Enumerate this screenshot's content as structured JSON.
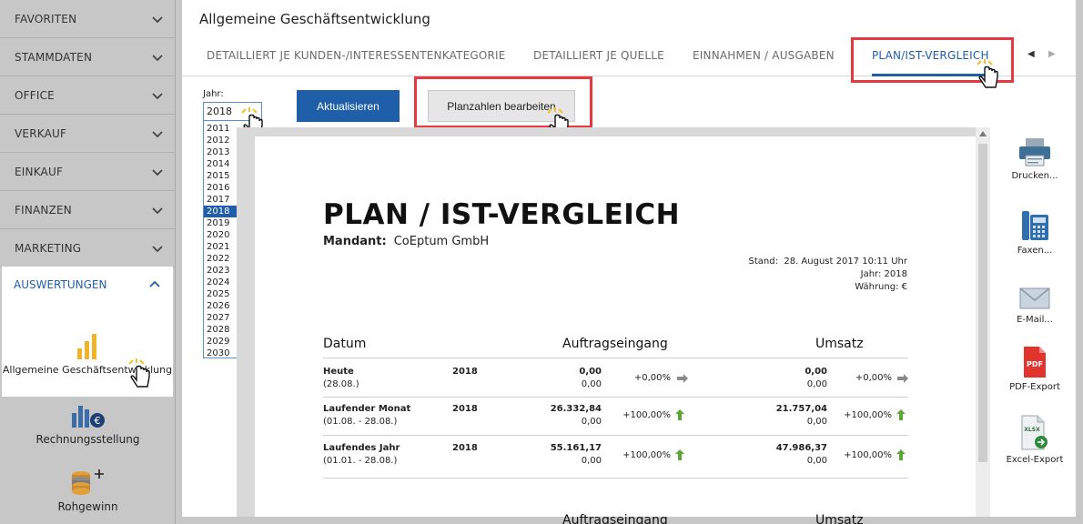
{
  "sidebar": {
    "items": [
      {
        "label": "FAVORITEN"
      },
      {
        "label": "STAMMDATEN"
      },
      {
        "label": "OFFICE"
      },
      {
        "label": "VERKAUF"
      },
      {
        "label": "EINKAUF"
      },
      {
        "label": "FINANZEN"
      },
      {
        "label": "MARKETING"
      }
    ],
    "open_section": {
      "label": "AUSWERTUNGEN",
      "item": "Allgemeine Geschäftsentwicklung"
    },
    "extra_items": [
      {
        "label": "Rechnungsstellung"
      },
      {
        "label": "Rohgewinn"
      }
    ]
  },
  "main": {
    "title": "Allgemeine Geschäftsentwicklung",
    "tabs": [
      {
        "label": "DETAILLIERT JE KUNDEN-/INTERESSENTENKATEGORIE"
      },
      {
        "label": "DETAILLIERT JE QUELLE"
      },
      {
        "label": "EINNAHMEN / AUSGABEN"
      },
      {
        "label": "PLAN/IST-VERGLEICH"
      }
    ],
    "tab_nav": {
      "prev": "◀",
      "next": "▶"
    }
  },
  "year_select": {
    "label": "Jahr:",
    "value": "2018",
    "options": [
      "2011",
      "2012",
      "2013",
      "2014",
      "2015",
      "2016",
      "2017",
      "2018",
      "2019",
      "2020",
      "2021",
      "2022",
      "2023",
      "2024",
      "2025",
      "2026",
      "2027",
      "2028",
      "2029",
      "2030"
    ],
    "selected": "2018"
  },
  "buttons": {
    "refresh": "Aktualisieren",
    "edit_plan": "Planzahlen bearbeiten"
  },
  "report": {
    "title": "PLAN / IST-VERGLEICH",
    "mandant_label": "Mandant:",
    "mandant_value": "CoEptum GmbH",
    "stand_label": "Stand:",
    "stand_value": "28. August 2017 10:11 Uhr",
    "jahr": "Jahr: 2018",
    "waehrung": "Währung: €",
    "columns": {
      "datum": "Datum",
      "auftrag": "Auftragseingang",
      "umsatz": "Umsatz"
    },
    "rows": [
      {
        "name": "Heute",
        "range": "(28.08.)",
        "year": "2018",
        "auftrag_ist": "0,00",
        "auftrag_plan": "0,00",
        "auftrag_pct": "+0,00%",
        "auftrag_trend": "flat",
        "umsatz_ist": "0,00",
        "umsatz_plan": "0,00",
        "umsatz_pct": "+0,00%",
        "umsatz_trend": "flat"
      },
      {
        "name": "Laufender Monat",
        "range": "(01.08. - 28.08.)",
        "year": "2018",
        "auftrag_ist": "26.332,84",
        "auftrag_plan": "0,00",
        "auftrag_pct": "+100,00%",
        "auftrag_trend": "up",
        "umsatz_ist": "21.757,04",
        "umsatz_plan": "0,00",
        "umsatz_pct": "+100,00%",
        "umsatz_trend": "up"
      },
      {
        "name": "Laufendes Jahr",
        "range": "(01.01. - 28.08.)",
        "year": "2018",
        "auftrag_ist": "55.161,17",
        "auftrag_plan": "0,00",
        "auftrag_pct": "+100,00%",
        "auftrag_trend": "up",
        "umsatz_ist": "47.986,37",
        "umsatz_plan": "0,00",
        "umsatz_pct": "+100,00%",
        "umsatz_trend": "up"
      }
    ],
    "second_header": {
      "auftrag": "Auftragseingang",
      "umsatz": "Umsatz"
    }
  },
  "actions": [
    {
      "label": "Drucken...",
      "icon": "printer-icon"
    },
    {
      "label": "Faxen...",
      "icon": "fax-icon"
    },
    {
      "label": "E-Mail...",
      "icon": "email-icon"
    },
    {
      "label": "PDF-Export",
      "icon": "pdf-icon",
      "badge": "PDF"
    },
    {
      "label": "Excel-Export",
      "icon": "xlsx-icon",
      "badge": "XLSX"
    }
  ],
  "colors": {
    "accent": "#1f5ea8",
    "highlight": "#e5383f",
    "trend_up": "#5aa832",
    "trend_flat": "#8a8a8a"
  }
}
